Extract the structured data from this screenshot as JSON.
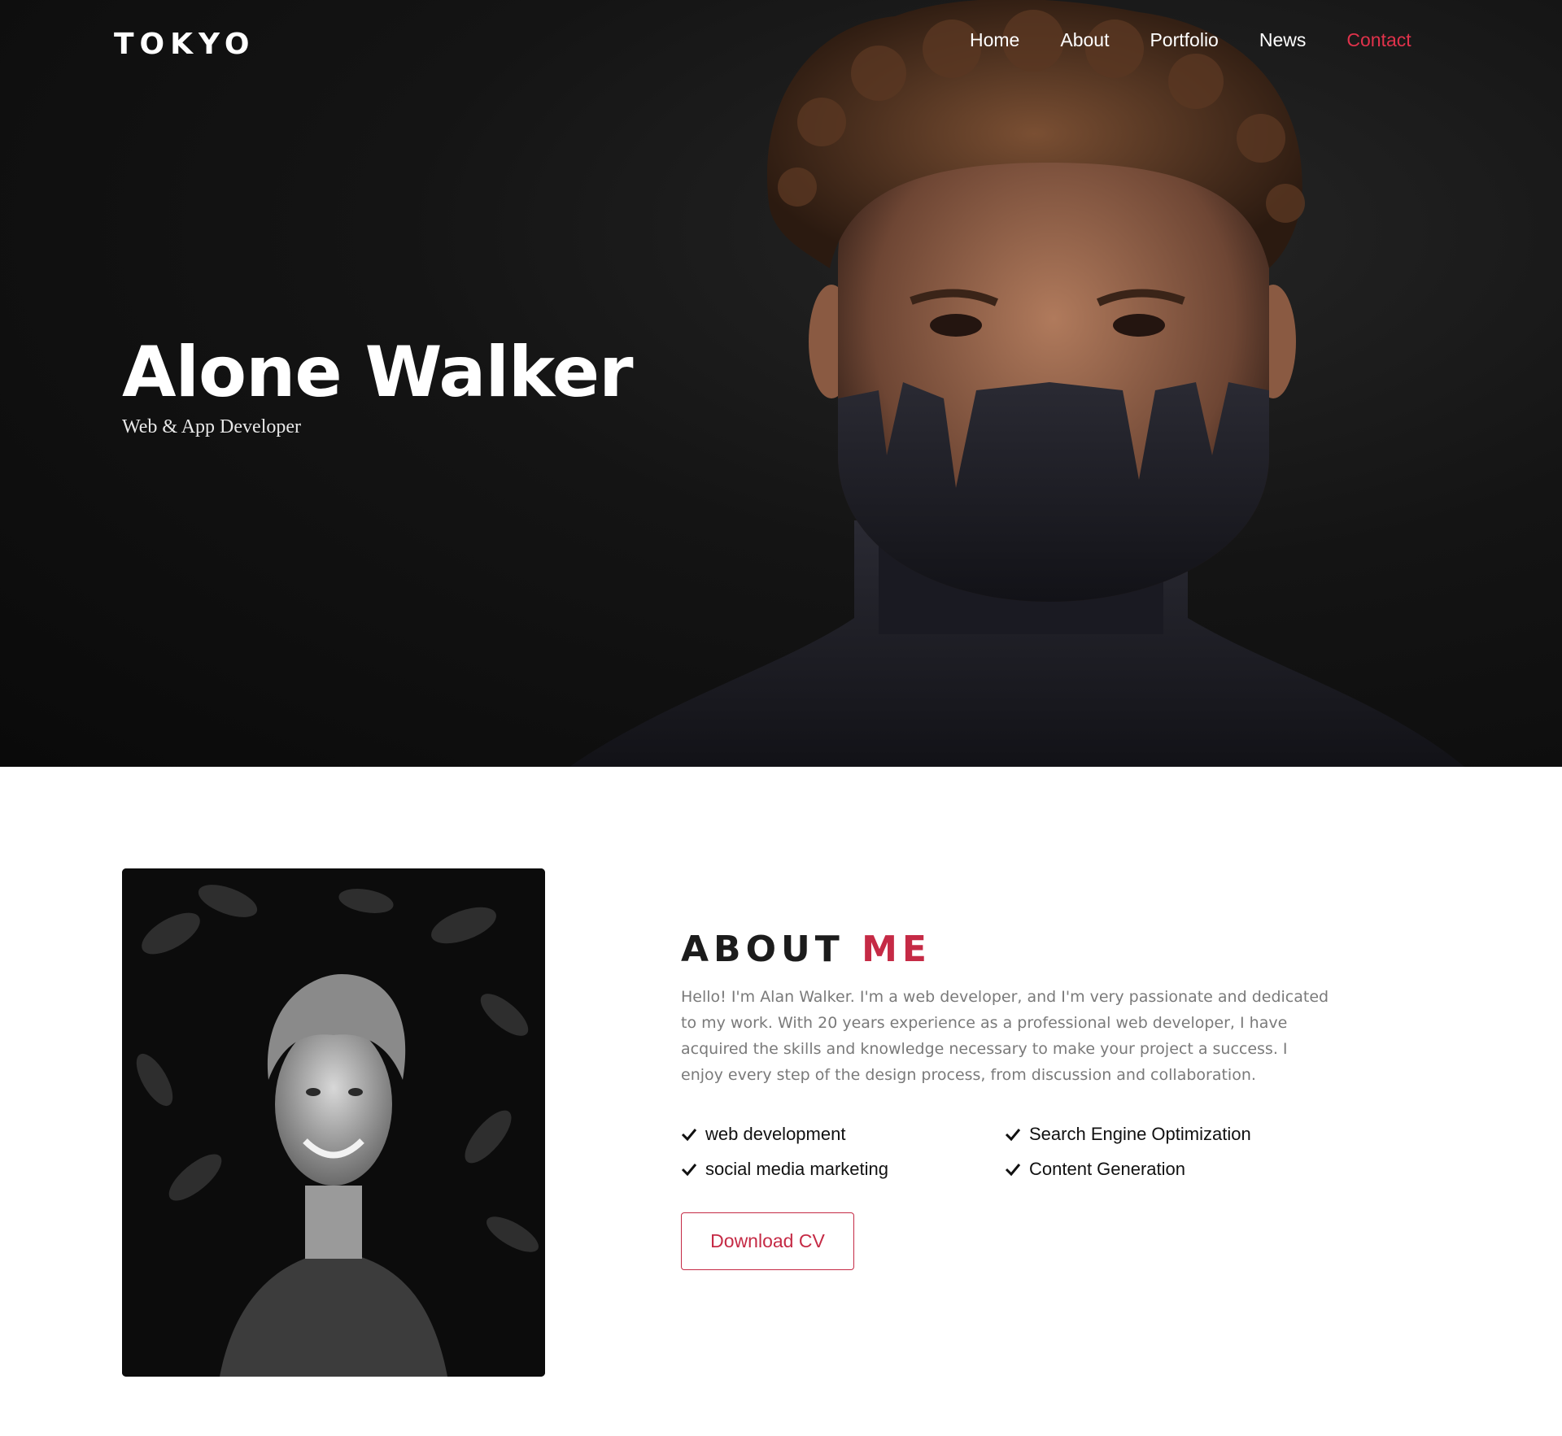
{
  "header": {
    "logo": "TOKYO",
    "nav": [
      {
        "label": "Home"
      },
      {
        "label": "About"
      },
      {
        "label": "Portfolio"
      },
      {
        "label": "News"
      },
      {
        "label": "Contact"
      }
    ],
    "active_nav": "Contact",
    "accent_color": "#e0324b"
  },
  "hero": {
    "title": "Alone Walker",
    "subtitle": "Web & App Developer"
  },
  "about": {
    "heading_main": "ABOUT",
    "heading_accent": "ME",
    "accent_color": "#c52a45",
    "paragraph": "Hello! I'm Alan Walker. I'm a web developer, and I'm very passionate and dedicated to my work. With 20 years experience as a professional web developer, I have acquired the skills and knowledge necessary to make your project a success. I enjoy every step of the design process, from discussion and collaboration.",
    "skills": [
      {
        "label": "web development",
        "icon": "check-icon"
      },
      {
        "label": "Search Engine Optimization",
        "icon": "check-icon"
      },
      {
        "label": "social media marketing",
        "icon": "check-icon"
      },
      {
        "label": "Content Generation",
        "icon": "check-icon"
      }
    ],
    "button_label": "Download CV"
  }
}
